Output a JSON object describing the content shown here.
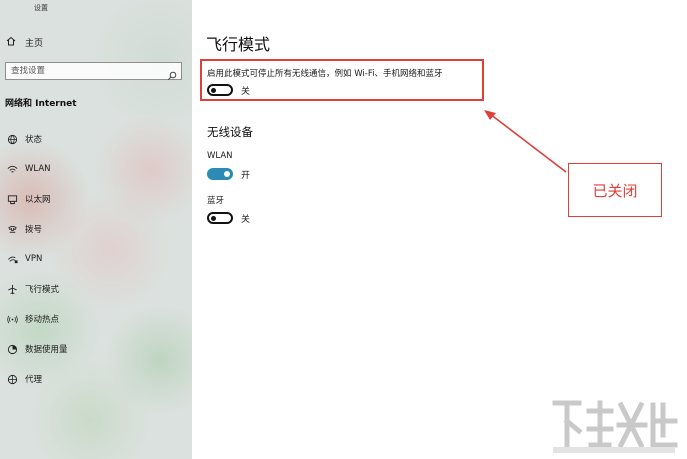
{
  "window": {
    "title": "设置"
  },
  "sidebar": {
    "home_label": "主页",
    "search_placeholder": "查找设置",
    "section_title": "网络和 Internet",
    "items": [
      {
        "label": "状态",
        "icon": "globe-icon"
      },
      {
        "label": "WLAN",
        "icon": "wifi-icon"
      },
      {
        "label": "以太网",
        "icon": "ethernet-icon"
      },
      {
        "label": "拨号",
        "icon": "dialup-icon"
      },
      {
        "label": "VPN",
        "icon": "vpn-icon"
      },
      {
        "label": "飞行模式",
        "icon": "airplane-icon"
      },
      {
        "label": "移动热点",
        "icon": "hotspot-icon"
      },
      {
        "label": "数据使用量",
        "icon": "data-usage-icon"
      },
      {
        "label": "代理",
        "icon": "proxy-globe-icon"
      }
    ]
  },
  "main": {
    "title": "飞行模式",
    "airplane": {
      "description": "启用此模式可停止所有无线通信，例如 Wi-Fi、手机网络和蓝牙",
      "state_label": "关",
      "on": false
    },
    "wireless": {
      "title": "无线设备",
      "wlan": {
        "label": "WLAN",
        "state_label": "开",
        "on": true
      },
      "bluetooth": {
        "label": "蓝牙",
        "state_label": "关",
        "on": false
      }
    }
  },
  "annotation": {
    "text": "已关闭",
    "color": "#e0403a"
  },
  "colors": {
    "accent": "#2b8bb5",
    "annotation": "#e0403a"
  }
}
